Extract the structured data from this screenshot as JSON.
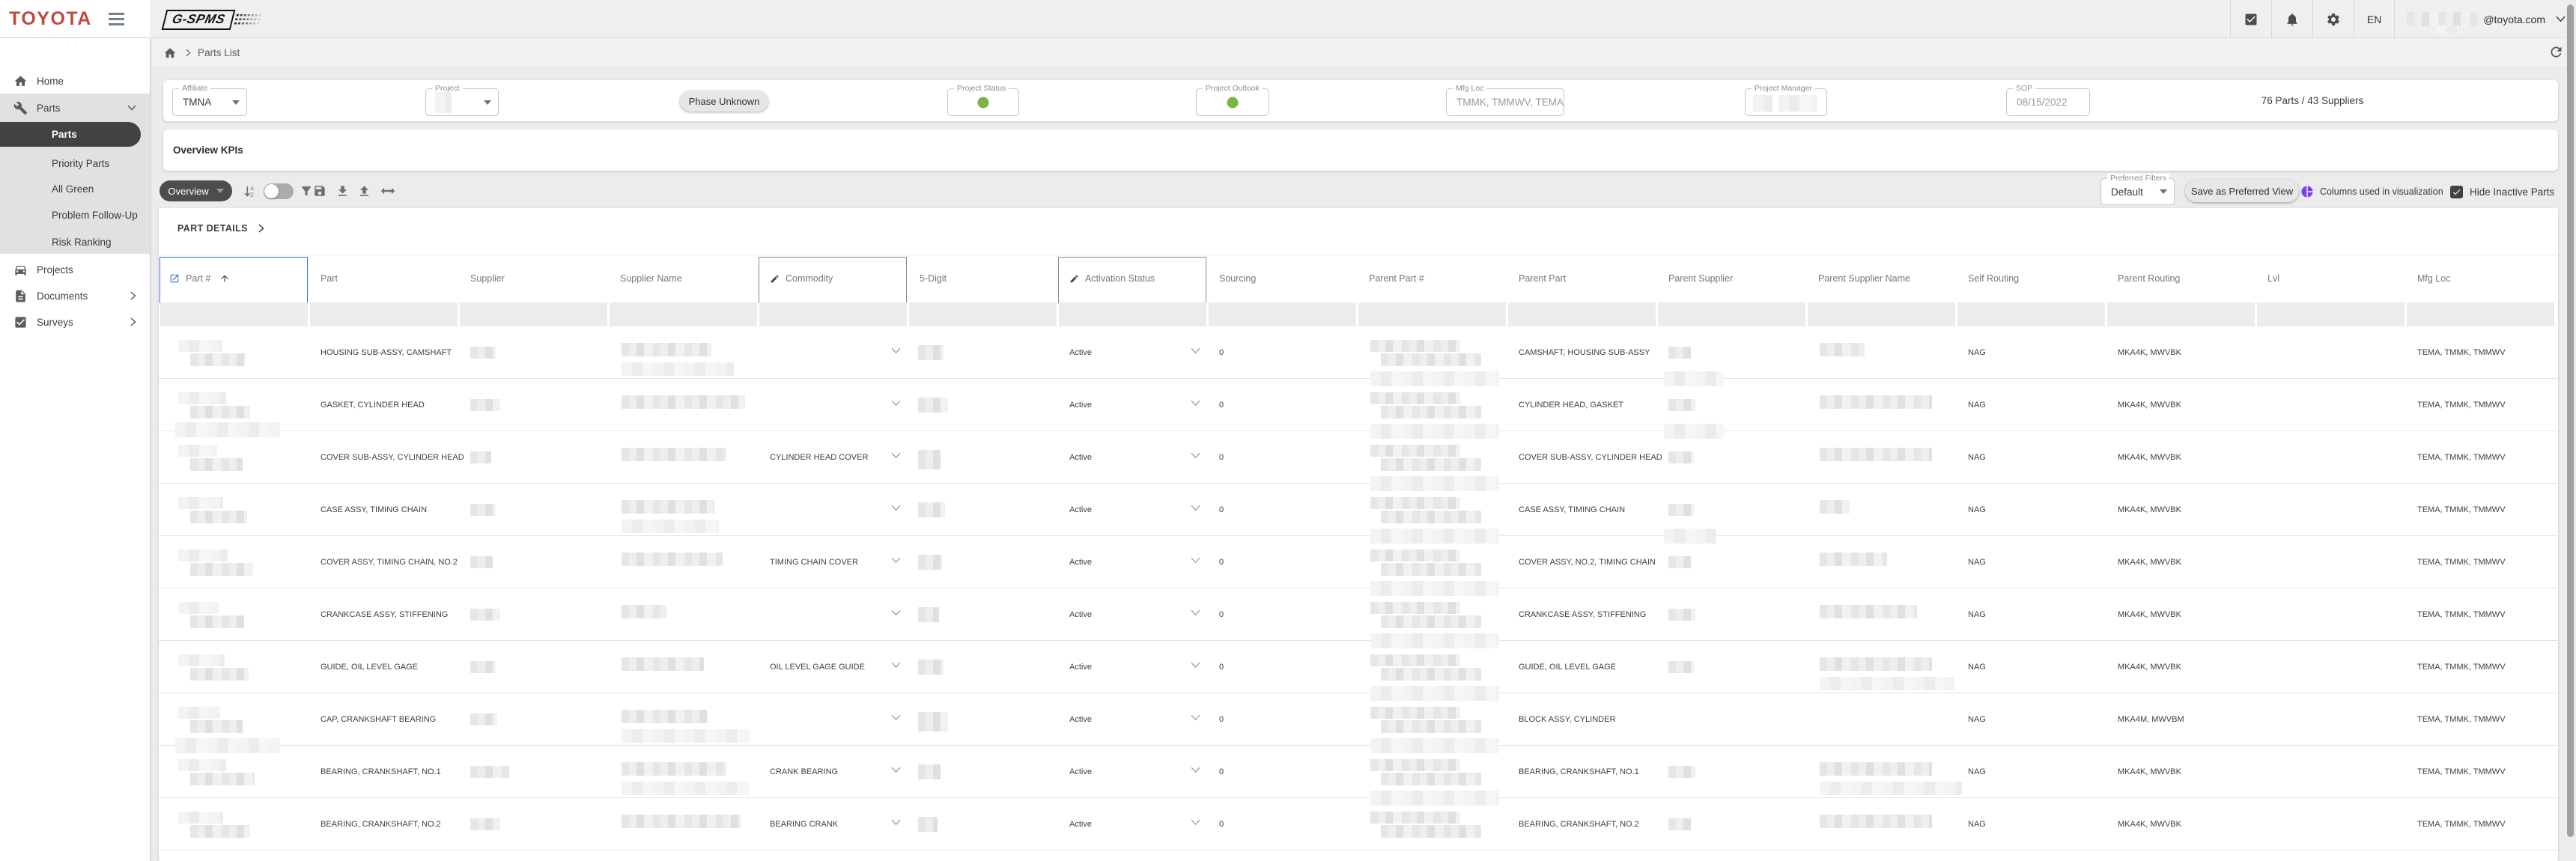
{
  "topbar": {
    "brand": "TOYOTA",
    "app_name": "G-SPMS",
    "language": "EN",
    "email_domain": "@toyota.com"
  },
  "sidebar": {
    "items": [
      {
        "label": "Home"
      },
      {
        "label": "Parts"
      },
      {
        "label": "Projects"
      },
      {
        "label": "Documents"
      },
      {
        "label": "Surveys"
      }
    ],
    "parts_children": [
      {
        "label": "Parts",
        "selected": true
      },
      {
        "label": "Priority Parts"
      },
      {
        "label": "All Green"
      },
      {
        "label": "Problem Follow-Up"
      },
      {
        "label": "Risk Ranking"
      }
    ]
  },
  "breadcrumb": {
    "current": "Parts List"
  },
  "filterbar": {
    "affiliate": {
      "label": "Affiliate",
      "value": "TMNA"
    },
    "project": {
      "label": "Project",
      "value": ""
    },
    "phase_chip": "Phase Unknown",
    "project_status": {
      "label": "Project Status",
      "color": "#7cb342"
    },
    "project_outlook": {
      "label": "Project Outlook",
      "color": "#7cb342"
    },
    "mfg_loc": {
      "label": "Mfg Loc",
      "value": "TMMK, TMMWV, TEMA"
    },
    "project_manager": {
      "label": "Project Manager",
      "value": ""
    },
    "sop": {
      "label": "SOP",
      "value": "08/15/2022"
    },
    "summary": "76 Parts / 43 Suppliers"
  },
  "kpi_section": {
    "title": "Overview KPIs"
  },
  "toolbar": {
    "view_button": "Overview",
    "preferred_filters": {
      "label": "Preferred Filters",
      "value": "Default"
    },
    "save_view": "Save as Preferred View",
    "viz_label": "Columns used in visualization",
    "viz_color": "#7e3ff2",
    "hide_inactive": {
      "label": "Hide Inactive Parts",
      "checked": true
    }
  },
  "part_details": {
    "title": "PART DETAILS"
  },
  "table": {
    "columns": [
      "Part #",
      "Part",
      "Supplier",
      "Supplier Name",
      "Commodity",
      "5-Digit",
      "Activation Status",
      "Sourcing",
      "Parent Part #",
      "Parent Part",
      "Parent Supplier",
      "Parent Supplier Name",
      "Self Routing",
      "Parent Routing",
      "Lvl",
      "Mfg Loc"
    ],
    "rows": [
      {
        "part": "HOUSING SUB-ASSY, CAMSHAFT",
        "commodity": "",
        "activation": "Active",
        "sourcing": "0",
        "parent_part": "CAMSHAFT, HOUSING SUB-ASSY",
        "self_routing": "NAG",
        "parent_routing": "MKA4K, MWVBK",
        "lvl": "",
        "mfg_loc": "TEMA, TMMK, TMMWV"
      },
      {
        "part": "GASKET, CYLINDER HEAD",
        "commodity": "",
        "activation": "Active",
        "sourcing": "0",
        "parent_part": "CYLINDER HEAD, GASKET",
        "self_routing": "NAG",
        "parent_routing": "MKA4K, MWVBK",
        "lvl": "",
        "mfg_loc": "TEMA, TMMK, TMMWV"
      },
      {
        "part": "COVER SUB-ASSY, CYLINDER HEAD",
        "commodity": "CYLINDER HEAD COVER",
        "activation": "Active",
        "sourcing": "0",
        "parent_part": "COVER SUB-ASSY, CYLINDER HEAD",
        "self_routing": "NAG",
        "parent_routing": "MKA4K, MWVBK",
        "lvl": "",
        "mfg_loc": "TEMA, TMMK, TMMWV"
      },
      {
        "part": "CASE ASSY, TIMING CHAIN",
        "commodity": "",
        "activation": "Active",
        "sourcing": "0",
        "parent_part": "CASE ASSY, TIMING CHAIN",
        "self_routing": "NAG",
        "parent_routing": "MKA4K, MWVBK",
        "lvl": "",
        "mfg_loc": "TEMA, TMMK, TMMWV"
      },
      {
        "part": "COVER ASSY, TIMING CHAIN, NO.2",
        "commodity": "TIMING CHAIN COVER",
        "activation": "Active",
        "sourcing": "0",
        "parent_part": "COVER ASSY, NO.2, TIMING CHAIN",
        "self_routing": "NAG",
        "parent_routing": "MKA4K, MWVBK",
        "lvl": "",
        "mfg_loc": "TEMA, TMMK, TMMWV"
      },
      {
        "part": "CRANKCASE ASSY, STIFFENING",
        "commodity": "",
        "activation": "Active",
        "sourcing": "0",
        "parent_part": "CRANKCASE ASSY, STIFFENING",
        "self_routing": "NAG",
        "parent_routing": "MKA4K, MWVBK",
        "lvl": "",
        "mfg_loc": "TEMA, TMMK, TMMWV"
      },
      {
        "part": "GUIDE, OIL LEVEL GAGE",
        "commodity": "OIL LEVEL GAGE GUIDE",
        "activation": "Active",
        "sourcing": "0",
        "parent_part": "GUIDE, OIL LEVEL GAGE",
        "self_routing": "NAG",
        "parent_routing": "MKA4K, MWVBK",
        "lvl": "",
        "mfg_loc": "TEMA, TMMK, TMMWV"
      },
      {
        "part": "CAP, CRANKSHAFT BEARING",
        "commodity": "",
        "activation": "Active",
        "sourcing": "0",
        "parent_part": "BLOCK ASSY, CYLINDER",
        "self_routing": "NAG",
        "parent_routing": "MKA4M, MWVBM",
        "lvl": "",
        "mfg_loc": "TEMA, TMMK, TMMWV"
      },
      {
        "part": "BEARING, CRANKSHAFT, NO.1",
        "commodity": "CRANK BEARING",
        "activation": "Active",
        "sourcing": "0",
        "parent_part": "BEARING, CRANKSHAFT, NO.1",
        "self_routing": "NAG",
        "parent_routing": "MKA4K, MWVBK",
        "lvl": "",
        "mfg_loc": "TEMA, TMMK, TMMWV"
      },
      {
        "part": "BEARING, CRANKSHAFT, NO.2",
        "commodity": "BEARING CRANK",
        "activation": "Active",
        "sourcing": "0",
        "parent_part": "BEARING, CRANKSHAFT, NO.2",
        "self_routing": "NAG",
        "parent_routing": "MKA4K, MWVBK",
        "lvl": "",
        "mfg_loc": "TEMA, TMMK, TMMWV"
      }
    ]
  }
}
